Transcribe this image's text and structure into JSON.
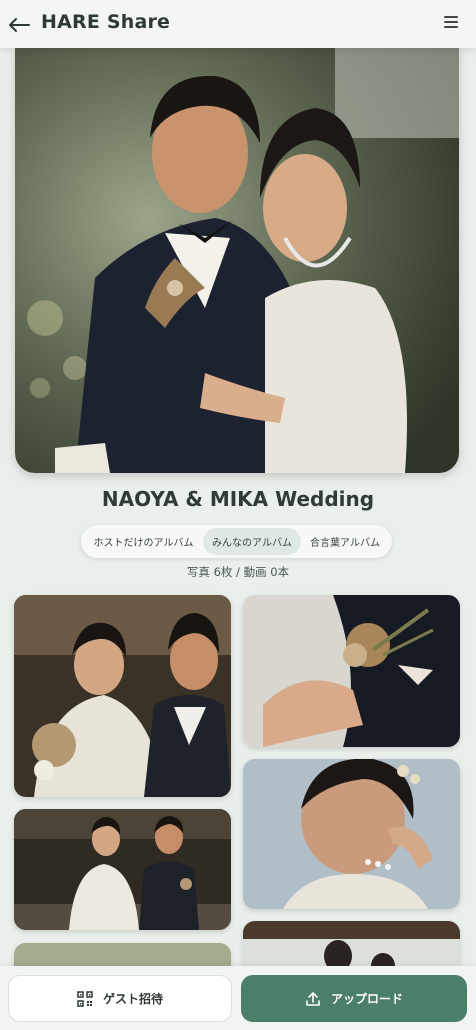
{
  "header": {
    "title": "HARE Share",
    "back_icon": "arrow-left-icon",
    "menu_icon": "hamburger-menu-icon"
  },
  "event": {
    "title": "NAOYA & MIKA Wedding"
  },
  "album_tabs": [
    {
      "label": "ホストだけのアルバム",
      "selected": false
    },
    {
      "label": "みんなのアルバム",
      "selected": true
    },
    {
      "label": "合言葉アルバム",
      "selected": false
    }
  ],
  "media_counts": "写真 6枚 / 動画 0本",
  "bottom_actions": {
    "invite_label": "ゲスト招待",
    "invite_icon": "qr-code-icon",
    "upload_label": "アップロード",
    "upload_icon": "upload-icon"
  },
  "colors": {
    "accent": "#4c7f67",
    "selected_tab": "#dfe8e2",
    "background": "#e9efeb"
  }
}
